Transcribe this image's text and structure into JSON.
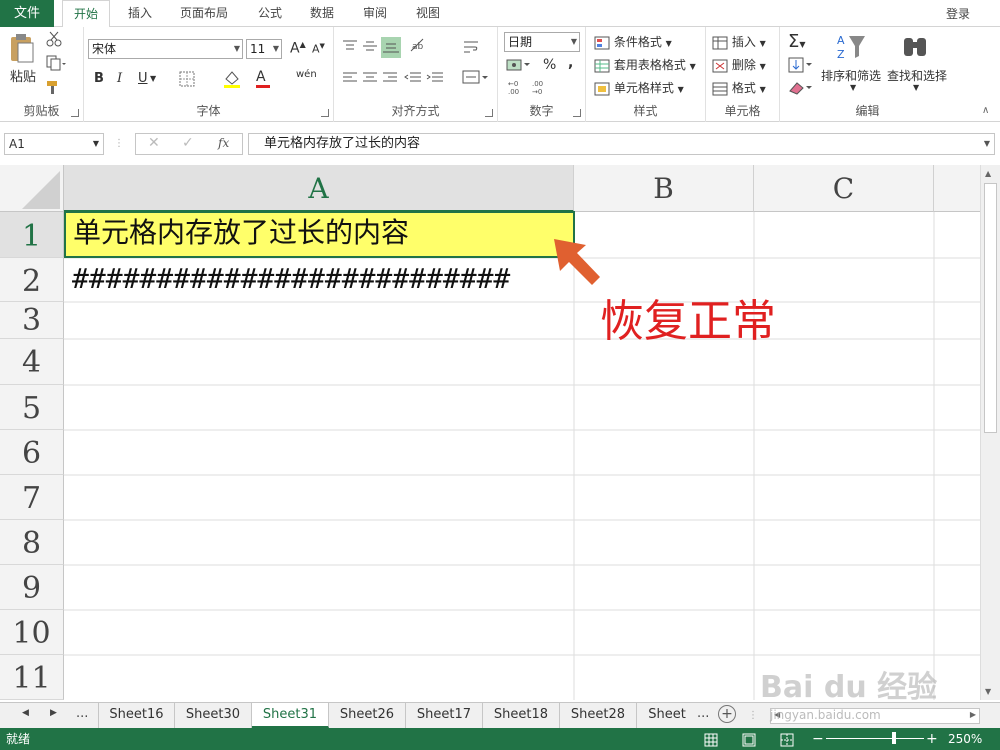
{
  "ribbon_tabs": {
    "file": "文件",
    "home": "开始",
    "insert": "插入",
    "page_layout": "页面布局",
    "formulas": "公式",
    "data": "数据",
    "review": "审阅",
    "view": "视图",
    "login": "登录"
  },
  "ribbon": {
    "clipboard": {
      "paste": "粘贴",
      "label": "剪贴板"
    },
    "font": {
      "name": "宋体",
      "size": "11",
      "bold": "B",
      "italic": "I",
      "underline": "U",
      "font_color_glyph": "A",
      "wen": "wén",
      "label": "字体"
    },
    "alignment": {
      "label": "对齐方式"
    },
    "number": {
      "format": "日期",
      "percent": "%",
      "comma": ",",
      "label": "数字"
    },
    "styles": {
      "conditional": "条件格式",
      "table": "套用表格格式",
      "cell_styles": "单元格样式",
      "label": "样式"
    },
    "cells": {
      "insert": "插入",
      "delete": "删除",
      "format": "格式",
      "label": "单元格"
    },
    "editing": {
      "sort_filter": "排序和筛选",
      "find_select": "查找和选择",
      "label": "编辑"
    }
  },
  "formula_bar": {
    "name_box": "A1",
    "fx": "fx",
    "content": "单元格内存放了过长的内容"
  },
  "columns": [
    "A",
    "B",
    "C"
  ],
  "rows": [
    "1",
    "2",
    "3",
    "4",
    "5",
    "6",
    "7",
    "8",
    "9",
    "10",
    "11"
  ],
  "cells": {
    "A1": "单元格内存放了过长的内容",
    "A2": "##########################"
  },
  "annotation": "恢复正常",
  "sheet_tabs": [
    "Sheet16",
    "Sheet30",
    "Sheet31",
    "Sheet26",
    "Sheet17",
    "Sheet18",
    "Sheet28",
    "Sheet"
  ],
  "active_sheet": "Sheet31",
  "sheet_nav": {
    "more": "..."
  },
  "status": {
    "ready": "就绪",
    "zoom": "250%"
  },
  "colors": {
    "accent": "#217346",
    "selected_cell": "#ffff6a",
    "annotation": "#e02020",
    "arrow": "#e06030"
  },
  "watermark": {
    "main": "Bai du 经验",
    "sub": "jingyan.baidu.com"
  }
}
